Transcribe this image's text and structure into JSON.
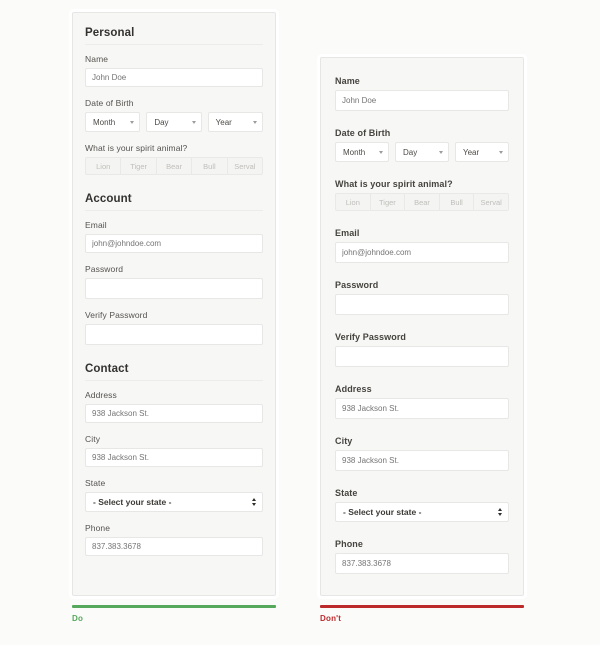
{
  "captions": {
    "do": "Do",
    "dont": "Don't",
    "do_color": "#56a85c",
    "dont_color": "#bd2a2c"
  },
  "labels": {
    "name": "Name",
    "date_of_birth": "Date of Birth",
    "spirit_animal": "What is your spirit animal?",
    "email": "Email",
    "password": "Password",
    "verify_password": "Verify Password",
    "address": "Address",
    "city": "City",
    "state": "State",
    "phone": "Phone"
  },
  "sections": {
    "personal": "Personal",
    "account": "Account",
    "contact": "Contact"
  },
  "placeholders": {
    "name": "John Doe",
    "email": "john@johndoe.com",
    "password": "",
    "verify_password": "",
    "address": "938 Jackson St.",
    "city": "938 Jackson St.",
    "phone": "837.383.3678"
  },
  "dob": {
    "month": "Month",
    "day": "Day",
    "year": "Year"
  },
  "spirit_animals": [
    "Lion",
    "Tiger",
    "Bear",
    "Bull",
    "Serval"
  ],
  "state_select": {
    "value": "- Select your state -"
  }
}
